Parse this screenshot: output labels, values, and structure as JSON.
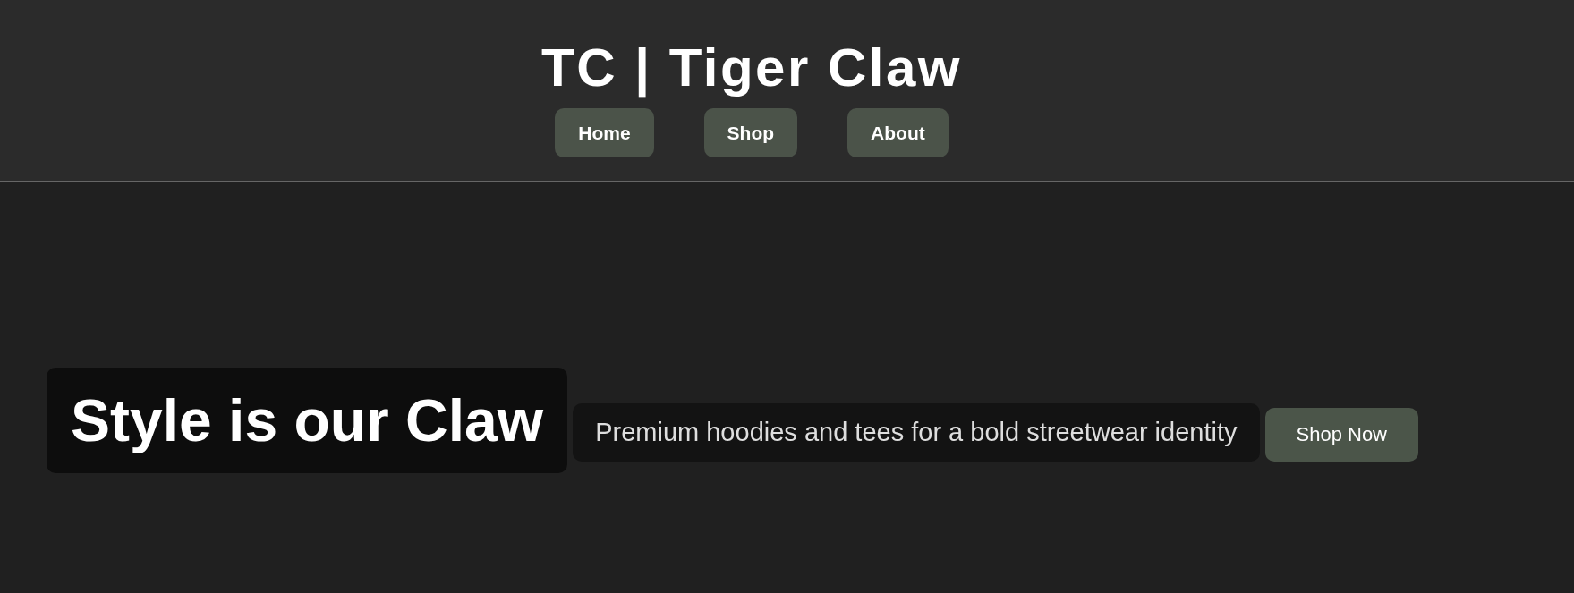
{
  "header": {
    "title": "TC | Tiger Claw",
    "nav": [
      {
        "label": "Home"
      },
      {
        "label": "Shop"
      },
      {
        "label": "About"
      }
    ]
  },
  "hero": {
    "heading": "Style is our Claw",
    "tagline": "Premium hoodies and tees for a bold streetwear identity",
    "button": "Shop Now"
  }
}
